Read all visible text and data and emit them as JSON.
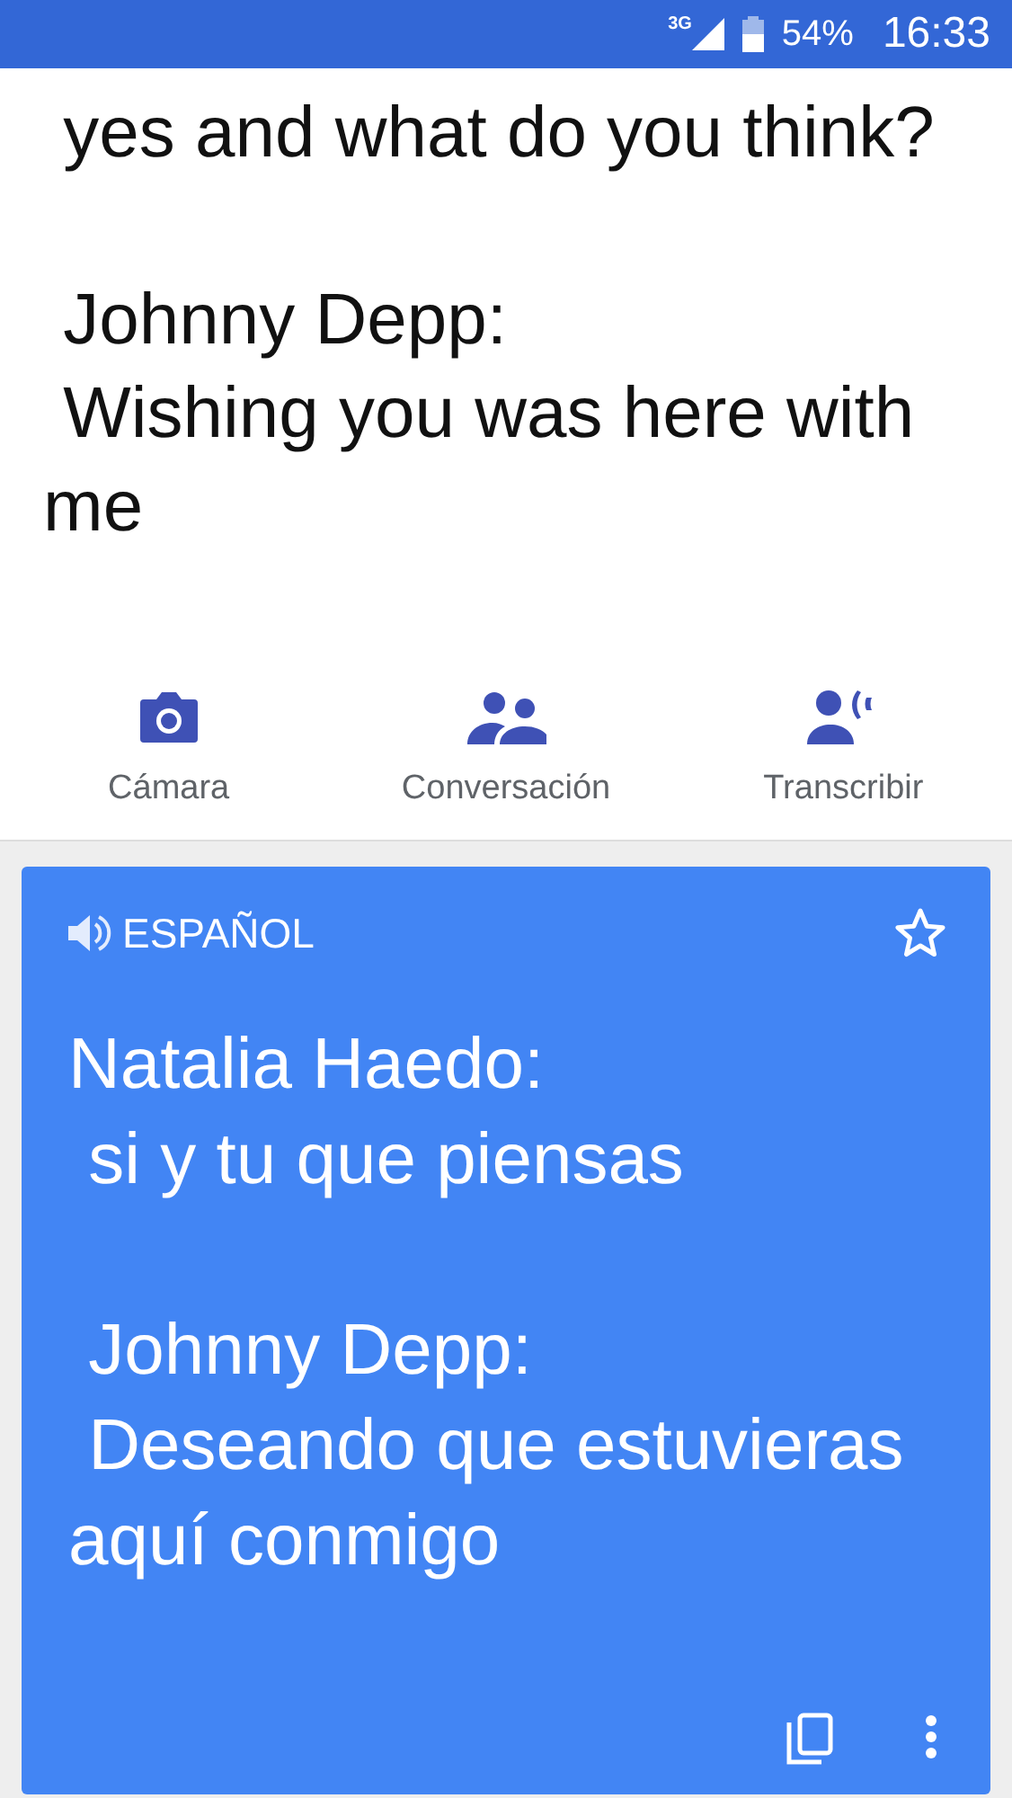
{
  "status_bar": {
    "network": "3G",
    "battery": "54%",
    "time": "16:33"
  },
  "source": {
    "text": " yes and what do you think?\n\n Johnny Depp:\n Wishing you was here with me"
  },
  "actions": [
    {
      "kind": "camera",
      "label": "Cámara"
    },
    {
      "kind": "conversation",
      "label": "Conversación"
    },
    {
      "kind": "transcribe",
      "label": "Transcribir"
    }
  ],
  "translation": {
    "language": "ESPAÑOL",
    "starred": false,
    "text": "Natalia Haedo:\n si y tu que piensas\n\n Johnny Depp:\n Deseando que estuvieras aquí conmigo"
  }
}
